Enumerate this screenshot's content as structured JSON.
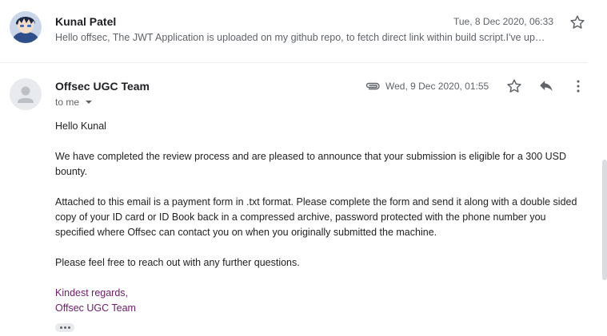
{
  "messages": [
    {
      "sender": "Kunal Patel",
      "date": "Tue, 8 Dec 2020, 06:33",
      "snippet": "Hello offsec, The JWT Application is uploaded on my github repo, to fetch direct link within build script.I've up…",
      "avatar_icon": "anime-avatar",
      "star_icon": "star-outline-icon"
    },
    {
      "sender": "Offsec UGC Team",
      "recipient_label": "to me",
      "date": "Wed, 9 Dec 2020, 01:55",
      "attachment_icon": "paperclip-icon",
      "actions": [
        "star-outline-icon",
        "reply-icon",
        "more-vert-icon"
      ],
      "body": {
        "greeting": "Hello Kunal",
        "paragraph1": "We have completed the review process and are pleased to announce that your submission is eligible for a 300 USD bounty.",
        "paragraph2": "Attached to this email is a payment form in .txt format. Please complete the form and send it along with a double sided copy of your ID card or ID Book back in a compressed archive, password protected with the phone number you specified where Offsec can contact you on when you originally submitted the machine.",
        "paragraph3": "Please feel free to reach out with any further questions.",
        "signoff": "Kindest regards,",
        "signature": "Offsec UGC Team"
      },
      "trimmed_content_icon": "ellipsis-icon"
    }
  ],
  "colors": {
    "signature": "#6a1b6a",
    "meta_text": "#5f6368",
    "divider": "#eceff1"
  }
}
